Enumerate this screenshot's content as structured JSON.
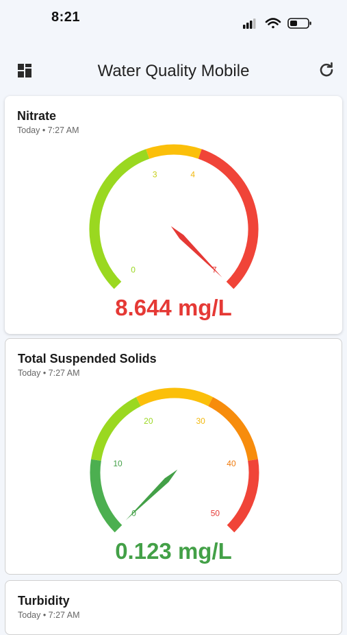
{
  "status": {
    "time": "8:21"
  },
  "header": {
    "title": "Water Quality Mobile",
    "menu_icon": "dashboard-grid-icon",
    "refresh_icon": "refresh-icon"
  },
  "cards": [
    {
      "title": "Nitrate",
      "timestamp": "Today • 7:27 AM",
      "value_text": "8.644 mg/L",
      "value_color": "#e53935",
      "gauge": {
        "min": 0,
        "max": 7,
        "value": 8.644,
        "ticks": [
          "0",
          "3",
          "4",
          "7"
        ],
        "tick_values": [
          0,
          3,
          4,
          7
        ],
        "tick_colors": [
          "#9ad820",
          "#c6cf18",
          "#f2b80c",
          "#e53935"
        ],
        "bands": [
          {
            "from": 0,
            "to": 3,
            "color": "#9ad820"
          },
          {
            "from": 3,
            "to": 4,
            "color": "#fbbf0a"
          },
          {
            "from": 4,
            "to": 7,
            "color": "#f04438"
          }
        ]
      }
    },
    {
      "title": "Total Suspended Solids",
      "timestamp": "Today • 7:27 AM",
      "value_text": "0.123 mg/L",
      "value_color": "#43a047",
      "gauge": {
        "min": 0,
        "max": 50,
        "value": 0.123,
        "ticks": [
          "0",
          "10",
          "20",
          "30",
          "40",
          "50"
        ],
        "tick_values": [
          0,
          10,
          20,
          30,
          40,
          50
        ],
        "tick_colors": [
          "#43a047",
          "#43a047",
          "#9ad820",
          "#f2b80c",
          "#f07a0c",
          "#e53935"
        ],
        "bands": [
          {
            "from": 0,
            "to": 10,
            "color": "#4caf50"
          },
          {
            "from": 10,
            "to": 20,
            "color": "#9ad820"
          },
          {
            "from": 20,
            "to": 30,
            "color": "#fbbf0a"
          },
          {
            "from": 30,
            "to": 40,
            "color": "#f78c0c"
          },
          {
            "from": 40,
            "to": 50,
            "color": "#f04438"
          }
        ]
      }
    },
    {
      "title": "Turbidity",
      "timestamp": "Today • 7:27 AM"
    }
  ]
}
